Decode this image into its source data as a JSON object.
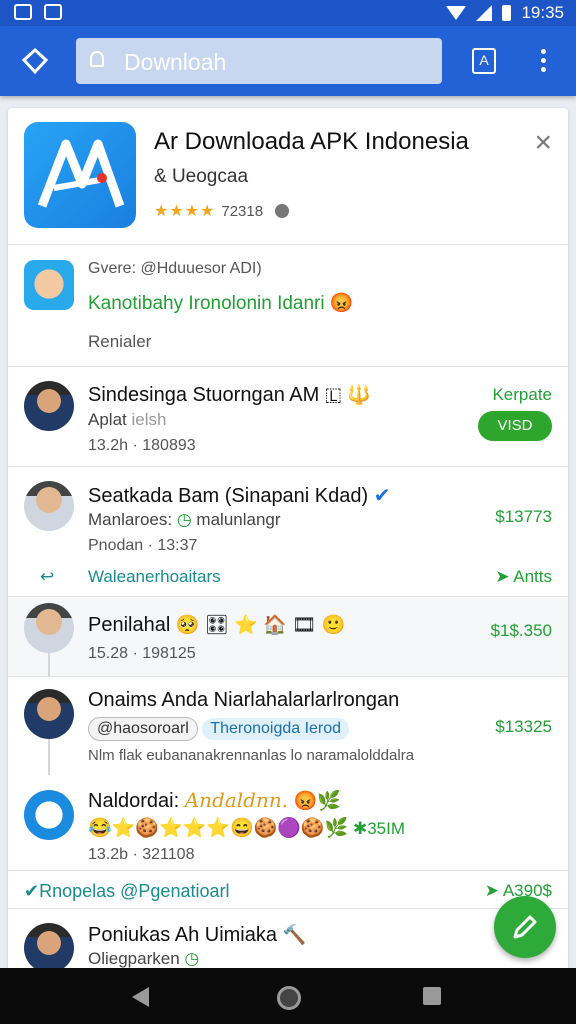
{
  "status_bar": {
    "time": "19:35"
  },
  "app_bar": {
    "search_placeholder": "Downloah",
    "download_glyph": "A"
  },
  "app_card": {
    "title": "Ar Downloada APK Indonesia",
    "developer": "& Ueogcaa",
    "rating_stars": "★★★★",
    "rating_count": "72318",
    "close_glyph": "×",
    "logo_color": "#1f8fe8"
  },
  "intro": {
    "label": "Gvere: @Hduuesor ADI)",
    "highlight": "Kanotibahy Ironolonin Idanri",
    "highlight_emoji": "😡",
    "footer": "Renialer"
  },
  "items": [
    {
      "name": "Sindesinga Stuorngan AM",
      "name_emoji": "🇱 🔱",
      "sub": "Aplat",
      "sub_faded": "ielsh",
      "meta": "13.2h · 180893",
      "action_label": "Kerpate",
      "button_label": "VISD"
    },
    {
      "name": "Seatkada Bam (Sinapani Kdad)",
      "sub": "Manlaroes:",
      "sub_tail": "malunlangr",
      "meta": "Pnodan · 13:37",
      "price": "$13773"
    },
    {
      "name": "Penilahal",
      "name_emoji": "🥺 🎛 ⭐ 🏠 🎞 🙂",
      "meta": "15.28 · 198125",
      "price": "$1$.350"
    },
    {
      "name": "Onaims Anda Niarlahalarlarlrongan",
      "chip_1": "@haosoroarl",
      "chip_2": "Theronoigda Ierod",
      "desc": "Nlm flak eubananakrennanlas lo naramalolddalra",
      "price": "$13325"
    },
    {
      "name": "Naldordai:",
      "name_tail": "Andaldnn.",
      "name_emoji": "😡🌿",
      "emoji_line": "😂⭐🍪⭐⭐⭐😄🍪🟣🍪🌿",
      "emoji_tail": "✱35IM",
      "meta": "13.2b · 321108"
    },
    {
      "name": "Poniukas Ah Uimiaka",
      "name_emoji": "🔨",
      "sub": "Oliegparken"
    }
  ],
  "section_reply": {
    "label": "Waleanerhoaitars",
    "action": "Antts",
    "reply_glyph": "↩"
  },
  "section_footer": {
    "label": "Rnopelas @Pgenatioarl",
    "action": "A390$",
    "check_glyph": "✔"
  }
}
